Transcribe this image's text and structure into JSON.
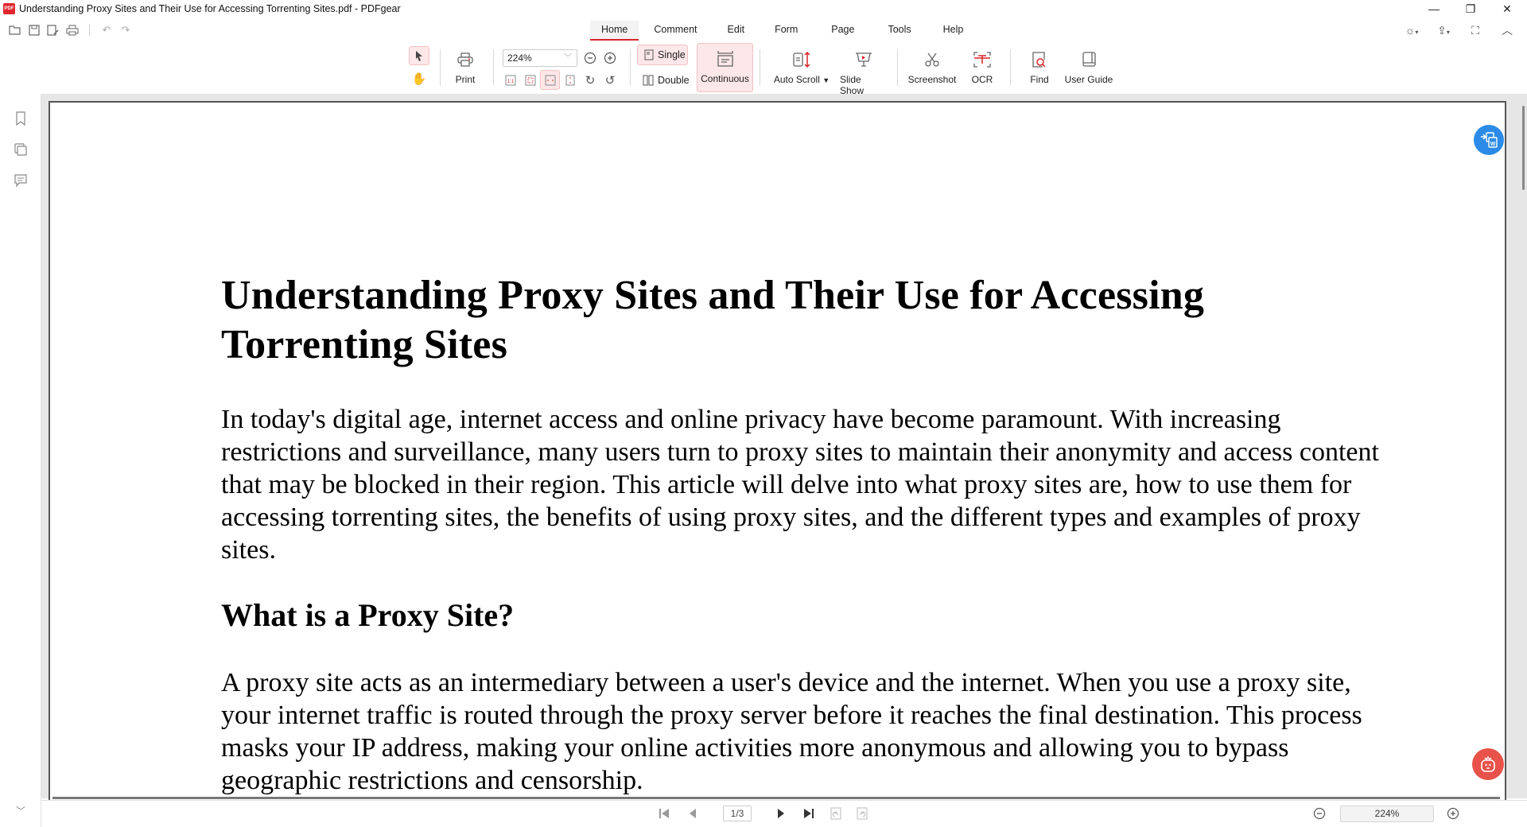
{
  "window": {
    "title": "Understanding Proxy Sites and Their Use for Accessing Torrenting Sites.pdf - PDFgear",
    "logo_text": "PDF",
    "controls": {
      "minimize": "—",
      "restore": "❐",
      "close": "✕"
    }
  },
  "quick_access": [
    "open-icon",
    "save-icon",
    "save-as-icon",
    "print-icon",
    "undo-icon",
    "redo-icon"
  ],
  "menu": {
    "tabs": [
      {
        "label": "Home",
        "active": true
      },
      {
        "label": "Comment",
        "active": false
      },
      {
        "label": "Edit",
        "active": false
      },
      {
        "label": "Form",
        "active": false
      },
      {
        "label": "Page",
        "active": false
      },
      {
        "label": "Tools",
        "active": false
      },
      {
        "label": "Help",
        "active": false
      }
    ]
  },
  "top_right": [
    "theme-icon",
    "share-icon",
    "fullscreen-icon",
    "collapse-ribbon-icon"
  ],
  "ribbon": {
    "print_label": "Print",
    "zoom_value": "224%",
    "single_label": "Single",
    "double_label": "Double",
    "continuous_label": "Continuous",
    "auto_scroll_label": "Auto Scroll",
    "slide_show_label": "Slide Show",
    "screenshot_label": "Screenshot",
    "ocr_label": "OCR",
    "find_label": "Find",
    "user_guide_label": "User Guide",
    "actual_size_label": "1:1"
  },
  "sidebar": [
    "bookmark-icon",
    "thumbnails-icon",
    "comments-icon"
  ],
  "document": {
    "title": "Understanding Proxy Sites and Their Use for Accessing Torrenting Sites",
    "intro": "In today's digital age, internet access and online privacy have become paramount. With increasing restrictions and surveillance, many users turn to proxy sites to maintain their anonymity and access content that may be blocked in their region. This article will delve into what proxy sites are, how to use them for accessing torrenting sites, the benefits of using proxy sites, and the different types and examples of proxy sites.",
    "section1_heading": "What is a Proxy Site?",
    "section1_para": "A proxy site acts as an intermediary between a user's device and the internet. When you use a proxy site, your internet traffic is routed through the proxy server before it reaches the final destination. This process masks your IP address, making your online activities more anonymous and allowing you to bypass geographic restrictions and censorship."
  },
  "status": {
    "page_indicator": "1/3",
    "zoom": "224%"
  },
  "colors": {
    "accent": "#d9252b",
    "selected_bg": "#fde7e8",
    "convert_fab": "#2b8be6",
    "assistant_fab": "#e9524a"
  }
}
